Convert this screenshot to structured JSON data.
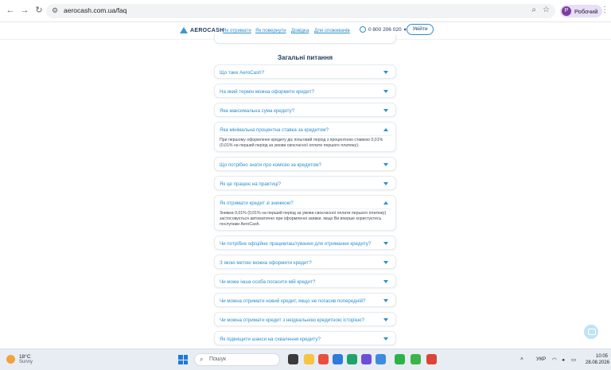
{
  "browser": {
    "url": "aerocash.com.ua/faq",
    "profile_initial": "Р",
    "profile_label": "Робочий"
  },
  "site": {
    "logo_text": "AEROCASH",
    "nav": [
      "Як отримати",
      "Як повернути",
      "Довідка",
      "Для споживачів"
    ],
    "phone": "0 800 206 020",
    "login_label": "Увійти"
  },
  "faq": {
    "section_title": "Загальні питання",
    "items": [
      {
        "q": "Що таке AeroCash?",
        "open": false,
        "a": ""
      },
      {
        "q": "На який термін можна оформити кредит?",
        "open": false,
        "a": ""
      },
      {
        "q": "Яка максимальна сума кредиту?",
        "open": false,
        "a": ""
      },
      {
        "q": "Яка мінімальна процентна ставка за кредитом?",
        "open": true,
        "a": "При першому оформленні кредиту діє пільговий період з процентною ставкою 0,01% (0,01% на перший період за умови своєчасної оплати першого платежу)."
      },
      {
        "q": "Що потрібно знати про комісію за кредитом?",
        "open": false,
        "a": ""
      },
      {
        "q": "Як це працює на практиці?",
        "open": false,
        "a": ""
      },
      {
        "q": "Як отримати кредит зі знижкою?",
        "open": true,
        "a": "Знижка 0,01% (0,01% на перший період за умови своєчасної оплати першого платежу) застосовується автоматично при оформленні заявки, якщо Ви вперше користуєтесь послугами AeroCash."
      },
      {
        "q": "Чи потрібне офіційне працевлаштування для отримання кредиту?",
        "open": false,
        "a": ""
      },
      {
        "q": "З якою метою можна оформити кредит?",
        "open": false,
        "a": ""
      },
      {
        "q": "Чи може інша особа погасити мій кредит?",
        "open": false,
        "a": ""
      },
      {
        "q": "Чи можна отримати новий кредит, якщо не погасив попередній?",
        "open": false,
        "a": ""
      },
      {
        "q": "Чи можна отримати кредит з неідеальною кредитною історією?",
        "open": false,
        "a": ""
      },
      {
        "q": "Як підвищити шанси на схвалення кредиту?",
        "open": false,
        "a": ""
      }
    ]
  },
  "taskbar": {
    "weather_temp": "18°C",
    "weather_desc": "Sunny",
    "search_label": "Пошук",
    "lang": "УКР",
    "time": "10:05",
    "date": "28.08.2026"
  },
  "colors": {
    "accent": "#2b8fd0",
    "heading": "#1f3a5f",
    "taskbar": "#e8edf3"
  }
}
